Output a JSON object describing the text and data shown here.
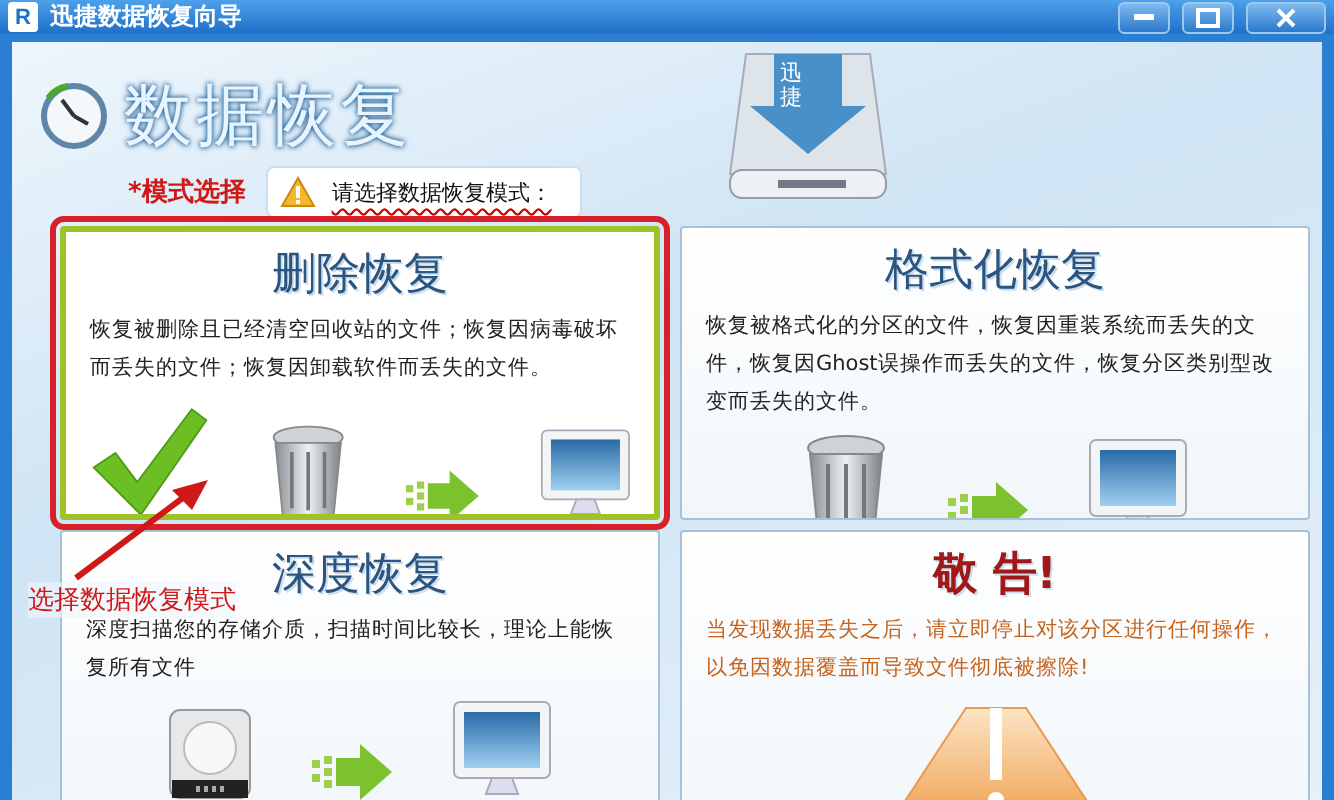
{
  "window": {
    "title": "迅捷数据恢复向导",
    "logo_text": "R"
  },
  "header": {
    "title": "数据恢复",
    "logo_text": "迅捷",
    "mode_label": "*模式选择",
    "prompt": "请选择数据恢复模式："
  },
  "cards": [
    {
      "kind": "mode",
      "title": "删除恢复",
      "description": "恢复被删除且已经清空回收站的文件；恢复因病毒破坏而丢失的文件；恢复因卸载软件而丢失的文件。",
      "selected": true
    },
    {
      "kind": "mode",
      "title": "格式化恢复",
      "description": "恢复被格式化的分区的文件，恢复因重装系统而丢失的文件，恢复因Ghost误操作而丢失的文件，恢复分区类别型改变而丢失的文件。",
      "selected": false
    },
    {
      "kind": "disk",
      "title": "深度恢复",
      "description": "深度扫描您的存储介质，扫描时间比较长，理论上能恢复所有文件",
      "selected": false
    },
    {
      "kind": "warning",
      "title": "敬 告!",
      "description": "当发现数据丢失之后，请立即停止对该分区进行任何操作，以免因数据覆盖而导致文件彻底被擦除!"
    }
  ],
  "annotation": {
    "text": "选择数据恢复模式"
  }
}
